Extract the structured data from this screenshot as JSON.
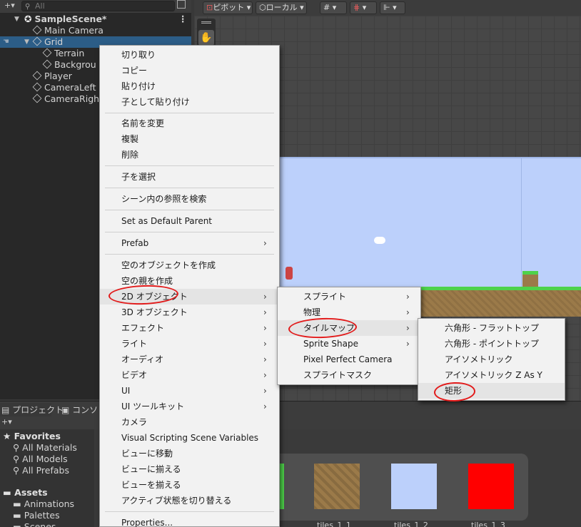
{
  "hierarchy": {
    "search_placeholder": "All",
    "scene_name": "SampleScene*",
    "items": [
      {
        "label": "Main Camera"
      },
      {
        "label": "Grid"
      },
      {
        "label": "Terrain"
      },
      {
        "label": "Backgrou"
      },
      {
        "label": "Player"
      },
      {
        "label": "CameraLeft"
      },
      {
        "label": "CameraRigh"
      }
    ]
  },
  "scene_toolbar": {
    "pivot": "ピボット",
    "local": "ローカル"
  },
  "context_menu": {
    "items": [
      {
        "label": "切り取り"
      },
      {
        "label": "コピー"
      },
      {
        "label": "貼り付け"
      },
      {
        "label": "子として貼り付け"
      },
      {
        "label": "名前を変更"
      },
      {
        "label": "複製"
      },
      {
        "label": "削除"
      },
      {
        "label": "子を選択"
      },
      {
        "label": "シーン内の参照を検索"
      },
      {
        "label": "Set as Default Parent"
      },
      {
        "label": "Prefab"
      },
      {
        "label": "空のオブジェクトを作成"
      },
      {
        "label": "空の親を作成"
      },
      {
        "label": "2D オブジェクト"
      },
      {
        "label": "3D オブジェクト"
      },
      {
        "label": "エフェクト"
      },
      {
        "label": "ライト"
      },
      {
        "label": "オーディオ"
      },
      {
        "label": "ビデオ"
      },
      {
        "label": "UI"
      },
      {
        "label": "UI ツールキット"
      },
      {
        "label": "カメラ"
      },
      {
        "label": "Visual Scripting Scene Variables"
      },
      {
        "label": "ビューに移動"
      },
      {
        "label": "ビューに揃える"
      },
      {
        "label": "ビューを揃える"
      },
      {
        "label": "アクティブ状態を切り替える"
      },
      {
        "label": "Properties..."
      }
    ]
  },
  "submenu_2d": {
    "items": [
      {
        "label": "スプライト"
      },
      {
        "label": "物理"
      },
      {
        "label": "タイルマップ"
      },
      {
        "label": "Sprite Shape"
      },
      {
        "label": "Pixel Perfect Camera"
      },
      {
        "label": "スプライトマスク"
      }
    ]
  },
  "submenu_tilemap": {
    "items": [
      {
        "label": "六角形 - フラットトップ"
      },
      {
        "label": "六角形 - ポイントトップ"
      },
      {
        "label": "アイソメトリック"
      },
      {
        "label": "アイソメトリック Z As Y"
      },
      {
        "label": "矩形"
      }
    ]
  },
  "bottom_panel": {
    "tab_project": "プロジェクト",
    "tab_console": "コンソ",
    "favorites_label": "Favorites",
    "favorites": [
      "All Materials",
      "All Models",
      "All Prefabs"
    ],
    "assets_label": "Assets",
    "assets": [
      "Animations",
      "Palettes",
      "Scenes"
    ],
    "tiles": [
      "tiles_1_1",
      "tiles_1_2",
      "tiles_1_3"
    ]
  },
  "colors": {
    "selection": "#2c5d87",
    "annotation_circle": "#e21a1a",
    "sky": "#bcd0fb",
    "grass": "#4ed24a",
    "dirt": "#9b7a49",
    "tile_red": "#ff0000"
  }
}
